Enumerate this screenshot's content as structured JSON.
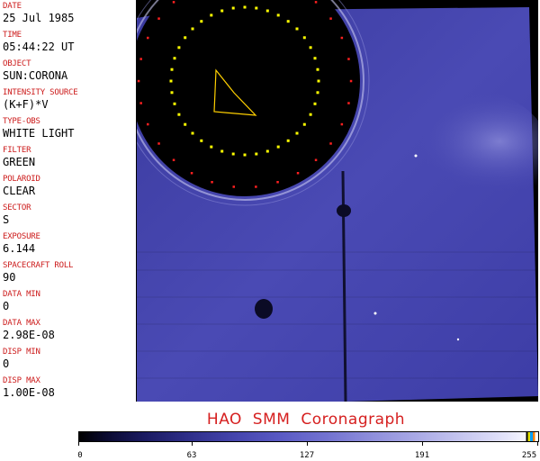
{
  "fields": [
    {
      "label": "DATE",
      "value": "25 Jul 1985"
    },
    {
      "label": "TIME",
      "value": "05:44:22 UT"
    },
    {
      "label": "OBJECT",
      "value": "SUN:CORONA"
    },
    {
      "label": "INTENSITY SOURCE",
      "value": "(K+F)*V"
    },
    {
      "label": "TYPE-OBS",
      "value": "WHITE LIGHT"
    },
    {
      "label": "FILTER",
      "value": "GREEN"
    },
    {
      "label": "POLAROID",
      "value": "CLEAR"
    },
    {
      "label": "SECTOR",
      "value": "S"
    },
    {
      "label": "EXPOSURE",
      "value": "6.144"
    },
    {
      "label": "SPACECRAFT ROLL",
      "value": "90"
    },
    {
      "label": "DATA MIN",
      "value": "0"
    },
    {
      "label": "DATA MAX",
      "value": "2.98E-08"
    },
    {
      "label": "DISP MIN",
      "value": "0"
    },
    {
      "label": "DISP MAX",
      "value": "1.00E-08"
    }
  ],
  "instrument_title": "HAO  SMM Coronagraph",
  "colorbar": {
    "ticks": [
      "0",
      "63",
      "127",
      "191",
      "255"
    ],
    "range": [
      0,
      255
    ]
  },
  "colors": {
    "label": "#cc1a1a",
    "title": "#d62020",
    "occulter": "#000000",
    "sky": "#4848b0",
    "sun_limb_markers": "#ffff00",
    "occulter_markers": "#ff2020"
  }
}
